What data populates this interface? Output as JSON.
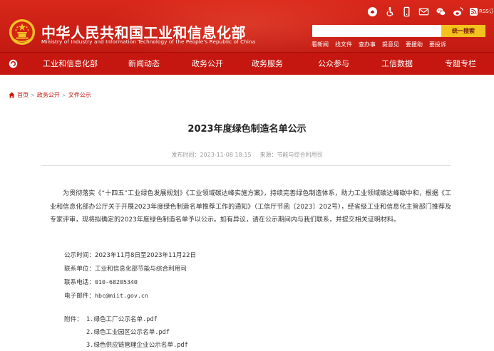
{
  "header": {
    "title": "中华人民共和国工业和信息化部",
    "subtitle": "Ministry of Industry and Information Technology of the People's Republic of China",
    "rss_label": "RSS订阅",
    "search": {
      "placeholder": "",
      "button": "统一搜索"
    },
    "quick_links": [
      "看新闻",
      "找文件",
      "查办事",
      "提意见",
      "要援助",
      "要投诉"
    ],
    "colors": {
      "brand_red": "#c5170f",
      "search_button": "#f4c21d"
    }
  },
  "nav": {
    "items": [
      "工业和信息化部",
      "新闻动态",
      "政务公开",
      "政务服务",
      "公众参与",
      "工信数据",
      "专题专栏"
    ]
  },
  "breadcrumb": {
    "items": [
      "首页",
      "政务公开",
      "文件公示"
    ],
    "separator": ">"
  },
  "article": {
    "title": "2023年度绿色制造名单公示",
    "published_label": "发布时间：",
    "published": "2023-11-08 18:15",
    "source_label": "来源：",
    "source": "节能与综合利用司",
    "body": "为贯彻落实《“十四五”工业绿色发展规划》《工业领域碳达峰实施方案》，持续完善绿色制造体系，助力工业领域碳达峰碳中和，根据《工业和信息化部办公厅关于开展2023年度绿色制造名单推荐工作的通知》（工信厅节函〔2023〕202号），经省级工业和信息化主管部门推荐及专家评审，现将拟确定的2023年度绿色制造名单予以公示。如有异议，请在公示期间内与我们联系，并提交相关证明材料。",
    "info": {
      "period_label": "公示时间：",
      "period": "2023年11月8日至2023年11月22日",
      "contact_label": "联系单位：",
      "contact": "工业和信息化部节能与综合利用司",
      "phone_label": "联系电话：",
      "phone": "010-68205340",
      "email_label": "电子邮件：",
      "email": "hbc@miit.gov.cn"
    },
    "attachments_label": "附件：",
    "attachments": [
      "1.绿色工厂公示名单.pdf",
      "2.绿色工业园区公示名单.pdf",
      "3.绿色供应链管理企业公示名单.pdf"
    ]
  }
}
